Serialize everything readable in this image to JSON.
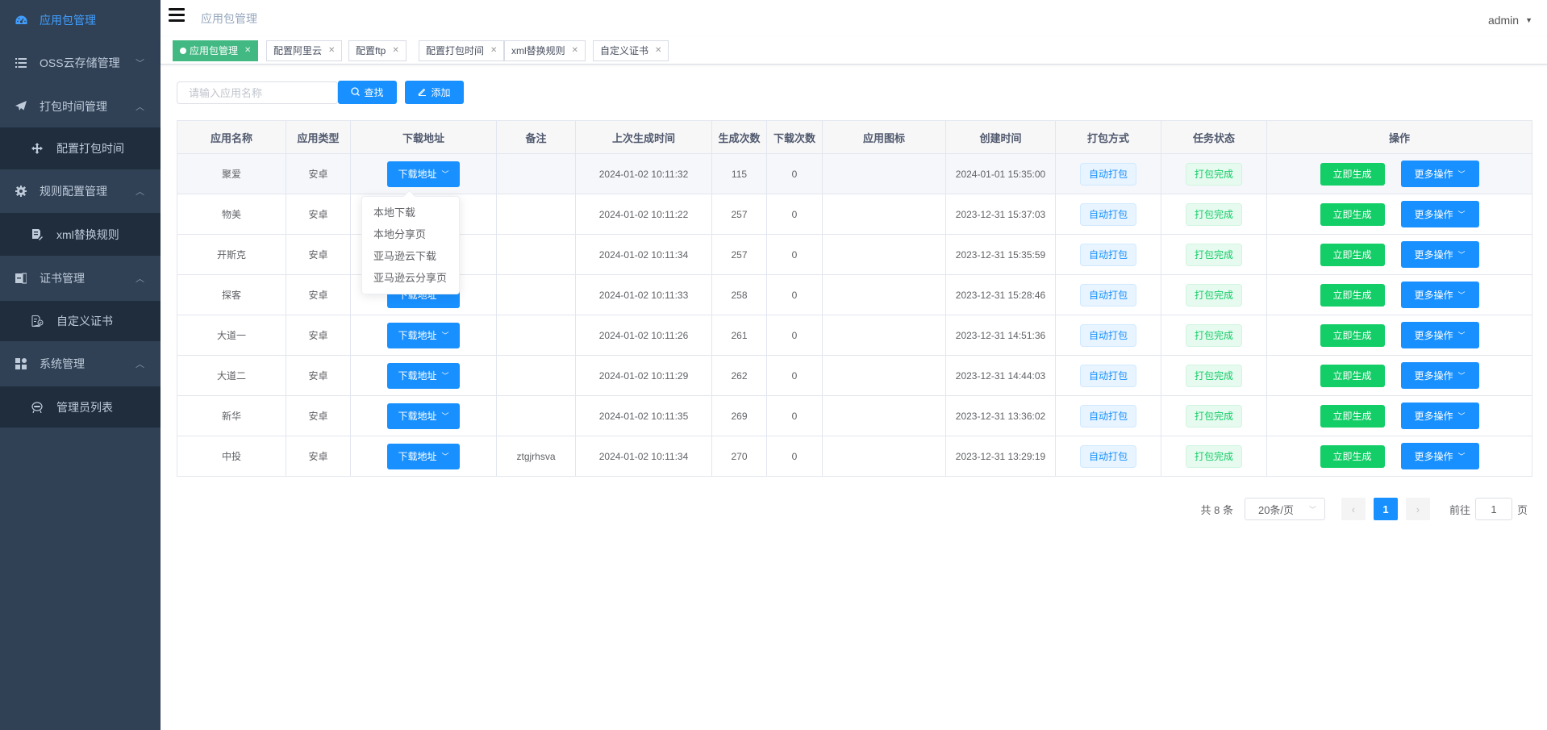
{
  "sidebar": {
    "items": [
      {
        "label": "应用包管理",
        "icon": "dashboard-icon",
        "active": true
      },
      {
        "label": "OSS云存储管理",
        "icon": "list-icon",
        "arrow": "chevron-down"
      },
      {
        "label": "打包时间管理",
        "icon": "paper-plane-icon",
        "arrow": "chevron-up",
        "children": [
          {
            "label": "配置打包时间",
            "icon": "move-icon"
          }
        ]
      },
      {
        "label": "规则配置管理",
        "icon": "gear-icon",
        "arrow": "chevron-up",
        "children": [
          {
            "label": "xml替换规则",
            "icon": "document-edit-icon"
          }
        ]
      },
      {
        "label": "证书管理",
        "icon": "certificate-icon",
        "arrow": "chevron-up",
        "children": [
          {
            "label": "自定义证书",
            "icon": "document-check-icon"
          }
        ]
      },
      {
        "label": "系统管理",
        "icon": "grid-icon",
        "arrow": "chevron-up",
        "children": [
          {
            "label": "管理员列表",
            "icon": "robot-icon"
          }
        ]
      }
    ]
  },
  "navbar": {
    "breadcrumb": "应用包管理",
    "user": "admin"
  },
  "tags": [
    {
      "label": "应用包管理",
      "active": true
    },
    {
      "label": "配置阿里云"
    },
    {
      "label": "配置ftp"
    },
    {
      "label": "配置打包时间"
    },
    {
      "label": "xml替换规则"
    },
    {
      "label": "自定义证书"
    }
  ],
  "search": {
    "placeholder": "请输入应用名称",
    "value": "",
    "search_label": "查找",
    "add_label": "添加"
  },
  "table": {
    "columns": [
      "应用名称",
      "应用类型",
      "下载地址",
      "备注",
      "上次生成时间",
      "生成次数",
      "下载次数",
      "应用图标",
      "创建时间",
      "打包方式",
      "任务状态",
      "操作"
    ],
    "download_label": "下载地址",
    "generate_label": "立即生成",
    "more_label": "更多操作",
    "rows": [
      {
        "name": "聚爱",
        "type": "安卓",
        "remark": "",
        "last_gen": "2024-01-02 10:11:32",
        "gen_count": "115",
        "dl_count": "0",
        "icon": "",
        "created": "2024-01-01 15:35:00",
        "pack_mode": "自动打包",
        "status": "打包完成"
      },
      {
        "name": "物美",
        "type": "安卓",
        "remark": "",
        "last_gen": "2024-01-02 10:11:22",
        "gen_count": "257",
        "dl_count": "0",
        "icon": "",
        "created": "2023-12-31 15:37:03",
        "pack_mode": "自动打包",
        "status": "打包完成"
      },
      {
        "name": "开斯克",
        "type": "安卓",
        "remark": "",
        "last_gen": "2024-01-02 10:11:34",
        "gen_count": "257",
        "dl_count": "0",
        "icon": "",
        "created": "2023-12-31 15:35:59",
        "pack_mode": "自动打包",
        "status": "打包完成"
      },
      {
        "name": "探客",
        "type": "安卓",
        "remark": "",
        "last_gen": "2024-01-02 10:11:33",
        "gen_count": "258",
        "dl_count": "0",
        "icon": "",
        "created": "2023-12-31 15:28:46",
        "pack_mode": "自动打包",
        "status": "打包完成"
      },
      {
        "name": "大道一",
        "type": "安卓",
        "remark": "",
        "last_gen": "2024-01-02 10:11:26",
        "gen_count": "261",
        "dl_count": "0",
        "icon": "",
        "created": "2023-12-31 14:51:36",
        "pack_mode": "自动打包",
        "status": "打包完成"
      },
      {
        "name": "大道二",
        "type": "安卓",
        "remark": "",
        "last_gen": "2024-01-02 10:11:29",
        "gen_count": "262",
        "dl_count": "0",
        "icon": "",
        "created": "2023-12-31 14:44:03",
        "pack_mode": "自动打包",
        "status": "打包完成"
      },
      {
        "name": "新华",
        "type": "安卓",
        "remark": "",
        "last_gen": "2024-01-02 10:11:35",
        "gen_count": "269",
        "dl_count": "0",
        "icon": "",
        "created": "2023-12-31 13:36:02",
        "pack_mode": "自动打包",
        "status": "打包完成"
      },
      {
        "name": "中投",
        "type": "安卓",
        "remark": "ztgjrhsva",
        "last_gen": "2024-01-02 10:11:34",
        "gen_count": "270",
        "dl_count": "0",
        "icon": "",
        "created": "2023-12-31 13:29:19",
        "pack_mode": "自动打包",
        "status": "打包完成"
      }
    ]
  },
  "download_menu": {
    "items": [
      "本地下载",
      "本地分享页",
      "亚马逊云下载",
      "亚马逊云分享页"
    ]
  },
  "pagination": {
    "total": "共 8 条",
    "page_size": "20条/页",
    "current": "1",
    "goto_prefix": "前往",
    "goto_value": "1",
    "goto_suffix": "页"
  },
  "colors": {
    "sidebar_bg": "#304156",
    "submenu_bg": "#1f2d3d",
    "primary": "#1890ff",
    "success": "#13ce66",
    "active_tag": "#42b983"
  }
}
